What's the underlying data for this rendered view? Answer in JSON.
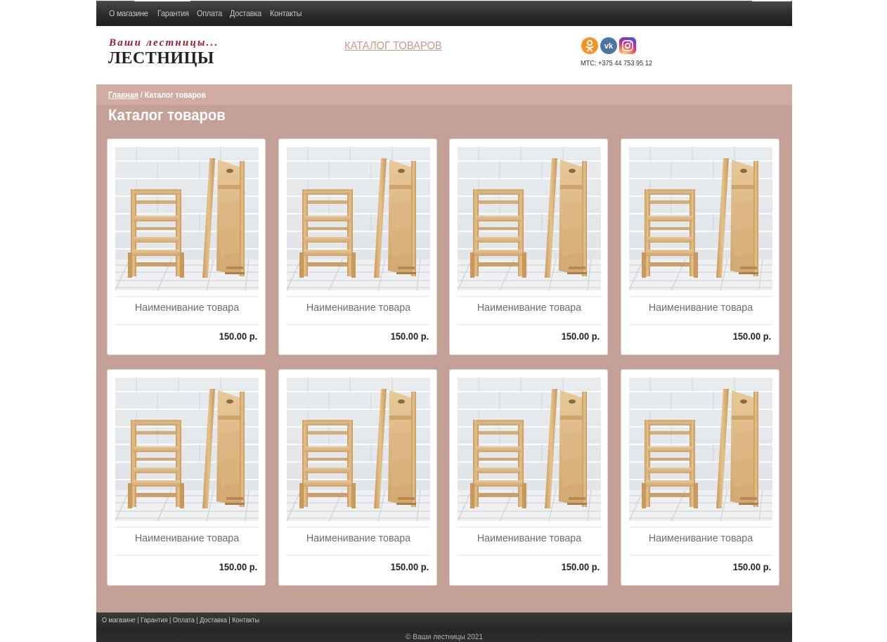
{
  "top_nav": {
    "items": [
      "О магазине",
      "Гарантия",
      "Оплата",
      "Доставка",
      "Контакты"
    ]
  },
  "header": {
    "tagline": "Ваши лестницы...",
    "logo": "ЛЕСТНИЦЫ",
    "catalog_link": "КАТАЛОГ ТОВАРОВ",
    "social_icons": [
      "odnoklassniki-icon",
      "vk-icon",
      "instagram-icon"
    ],
    "phone": "МТС: +375 44 753 95 12"
  },
  "breadcrumb": {
    "home": "Главная",
    "separator": " / ",
    "current": "Каталог товаров"
  },
  "page_title": "Каталог товаров",
  "products": [
    {
      "name": "Наименивание товара",
      "price": "150.00 р."
    },
    {
      "name": "Наименивание товара",
      "price": "150.00 р."
    },
    {
      "name": "Наименивание товара",
      "price": "150.00 р."
    },
    {
      "name": "Наименивание товара",
      "price": "150.00 р."
    },
    {
      "name": "Наименивание товара",
      "price": "150.00 р."
    },
    {
      "name": "Наименивание товара",
      "price": "150.00 р."
    },
    {
      "name": "Наименивание товара",
      "price": "150.00 р."
    },
    {
      "name": "Наименивание товара",
      "price": "150.00 р."
    }
  ],
  "footer": {
    "nav": [
      "О магазине",
      "Гарантия",
      "Оплата",
      "Доставка",
      "Контакты"
    ],
    "separator": " | ",
    "copyright": "© Ваши лестницы 2021"
  },
  "colors": {
    "content_bg": "#c4a097",
    "breadcrumb_bg": "#d1aca3",
    "tagline": "#a0192e",
    "catalog_link": "#c79a8f",
    "nav_bg": "#2b2b2b"
  }
}
